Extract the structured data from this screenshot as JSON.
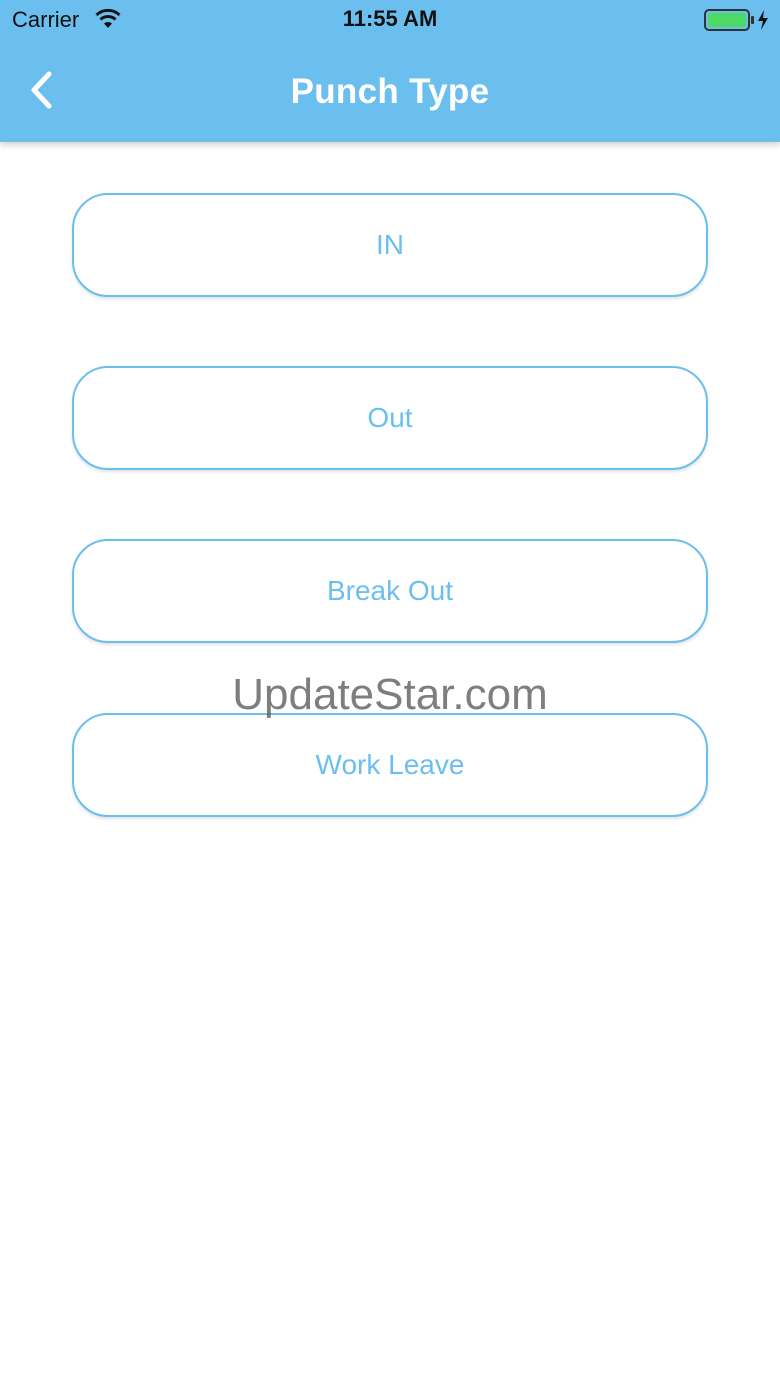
{
  "status_bar": {
    "carrier": "Carrier",
    "time": "11:55 AM",
    "wifi_icon": "wifi-icon",
    "battery_icon": "battery-charging-icon",
    "battery_color": "#4cd964"
  },
  "nav": {
    "back_icon": "chevron-left-icon",
    "title": "Punch Type",
    "background_color": "#6bbfee"
  },
  "punch_options": [
    {
      "label": "IN"
    },
    {
      "label": "Out"
    },
    {
      "label": "Break Out"
    },
    {
      "label": "Work Leave"
    }
  ],
  "accent_color": "#6bbfee",
  "watermark": "UpdateStar.com"
}
